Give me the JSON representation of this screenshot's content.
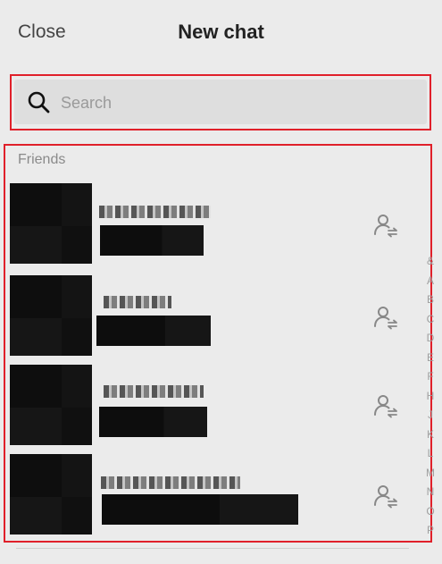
{
  "header": {
    "close_label": "Close",
    "title": "New chat"
  },
  "search": {
    "placeholder": "Search",
    "value": ""
  },
  "friends": {
    "section_label": "Friends",
    "rows": [
      {
        "name": "",
        "subtitle": "",
        "action_icon": "add-friend-icon"
      },
      {
        "name": "",
        "subtitle": "",
        "action_icon": "add-friend-icon"
      },
      {
        "name": "",
        "subtitle": "",
        "action_icon": "add-friend-icon"
      },
      {
        "name": "",
        "subtitle": "",
        "action_icon": "add-friend-icon"
      }
    ]
  },
  "alphabet_index": [
    "&",
    "A",
    "B",
    "C",
    "D",
    "E",
    "F",
    "H",
    "J",
    "K",
    "L",
    "M",
    "N",
    "O",
    "P"
  ],
  "colors": {
    "background": "#ebebeb",
    "highlight_border": "#e0202a",
    "search_bg": "#dedede"
  }
}
